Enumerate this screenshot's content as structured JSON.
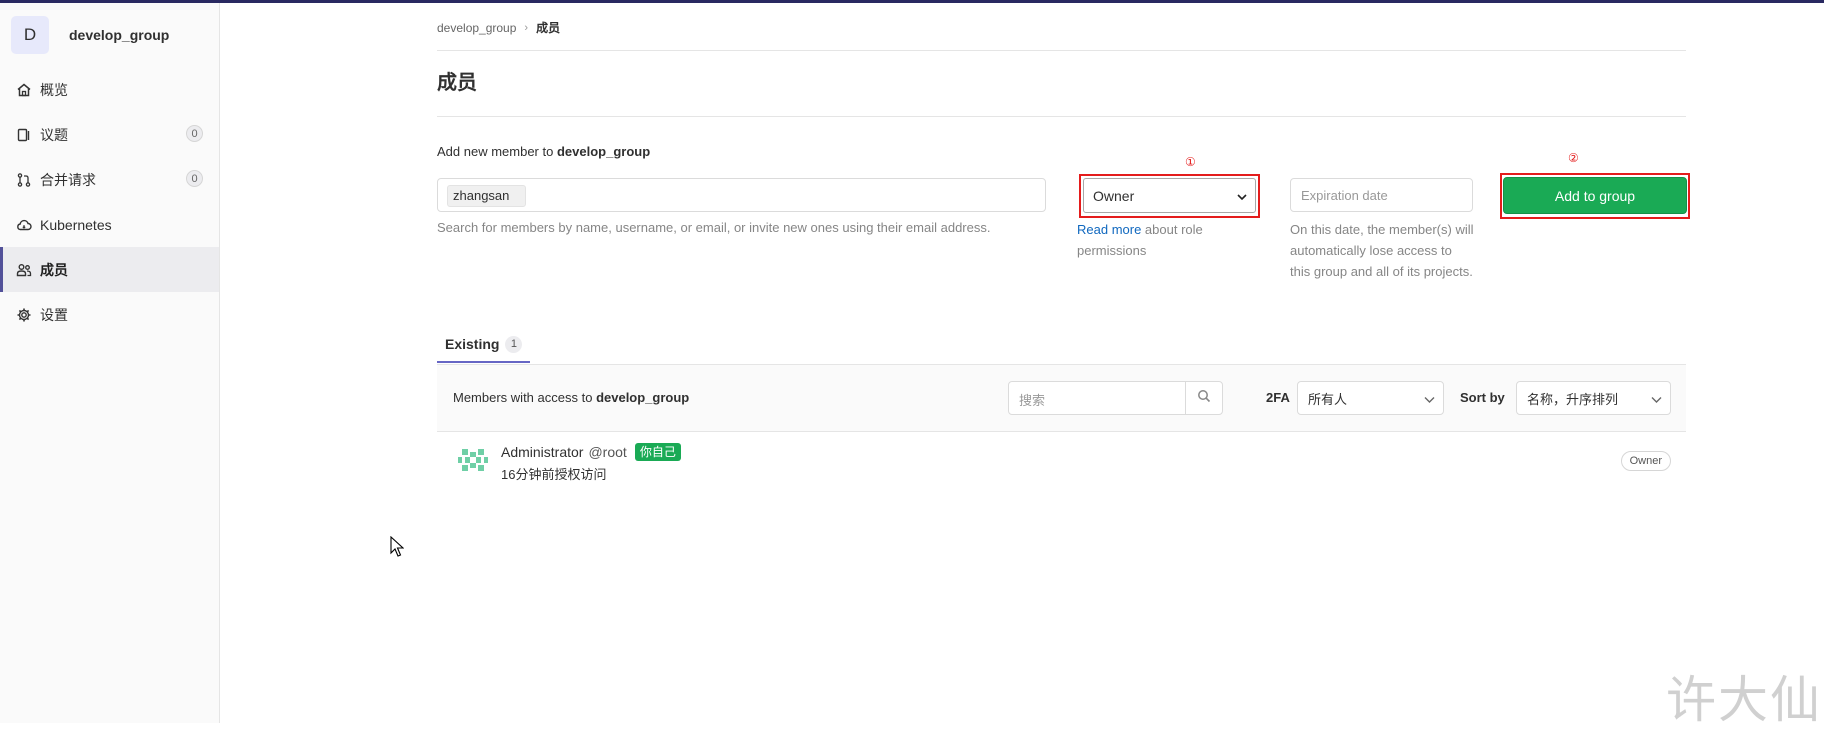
{
  "colors": {
    "accent": "#1aaa55",
    "highlight": "#e41c1c",
    "topbar": "#292961",
    "active_marker": "#525199"
  },
  "sidebar": {
    "group_avatar": "D",
    "group_name": "develop_group",
    "items": [
      {
        "label": "概览",
        "icon": "home-icon"
      },
      {
        "label": "议题",
        "icon": "issues-icon",
        "count": "0"
      },
      {
        "label": "合并请求",
        "icon": "merge-request-icon",
        "count": "0"
      },
      {
        "label": "Kubernetes",
        "icon": "cloud-icon"
      },
      {
        "label": "成员",
        "icon": "users-icon",
        "active": true
      },
      {
        "label": "设置",
        "icon": "gear-icon"
      }
    ]
  },
  "breadcrumb": {
    "parent": "develop_group",
    "current": "成员"
  },
  "page": {
    "title": "成员"
  },
  "invite": {
    "label_prefix": "Add new member to",
    "group": "develop_group",
    "member_token": "zhangsan",
    "member_help": "Search for members by name, username, or email, or invite new ones using their email address.",
    "role_marker": "①",
    "role_value": "Owner",
    "role_help_link": "Read more",
    "role_help_text": " about role permissions",
    "expiration_placeholder": "Expiration date",
    "expiration_help": "On this date, the member(s) will automatically lose access to this group and all of its projects.",
    "add_marker": "②",
    "add_button": "Add to group"
  },
  "tabs": [
    {
      "label": "Existing",
      "count": "1"
    }
  ],
  "members_bar": {
    "label_prefix": "Members with access to",
    "group": "develop_group",
    "search_placeholder": "搜索",
    "twofa_label": "2FA",
    "twofa_value": "所有人",
    "sort_label": "Sort by",
    "sort_value": "名称，升序排列"
  },
  "members": [
    {
      "name": "Administrator",
      "username": "@root",
      "badge": "你自己",
      "subtitle": "16分钟前授权访问",
      "role": "Owner"
    }
  ],
  "watermark": "许大仙"
}
